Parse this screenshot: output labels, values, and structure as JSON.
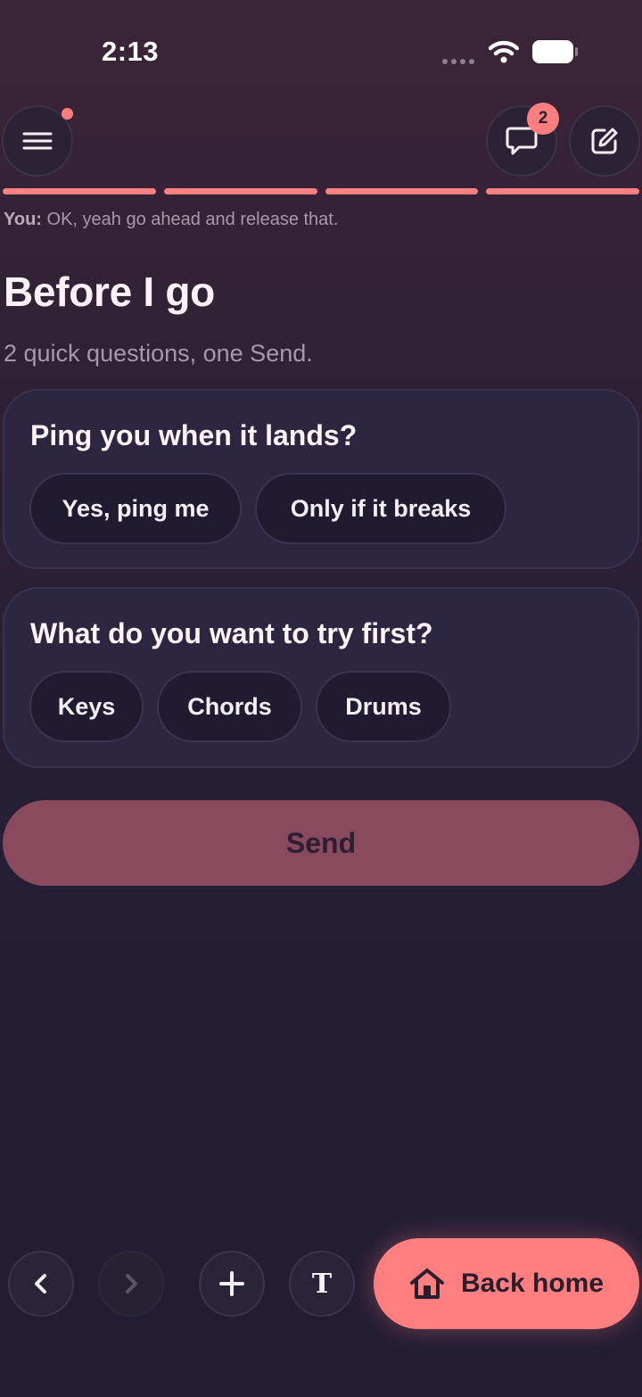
{
  "status_bar": {
    "time": "2:13"
  },
  "header": {
    "menu_icon": "hamburger-menu-icon",
    "chat_icon": "chat-bubble-icon",
    "chat_badge_count": "2",
    "edit_icon": "edit-square-icon",
    "progress_segments": 4,
    "progress_completed": 4
  },
  "last_message": {
    "speaker": "You:",
    "text": "OK, yeah go ahead and release that."
  },
  "page": {
    "title": "Before I go",
    "subtitle": "2 quick questions, one Send."
  },
  "questions": [
    {
      "question": "Ping you when it lands?",
      "options": [
        "Yes, ping me",
        "Only if it breaks"
      ]
    },
    {
      "question": "What do you want to try first?",
      "options": [
        "Keys",
        "Chords",
        "Drums"
      ]
    }
  ],
  "send_label": "Send",
  "toolbar": {
    "back_icon": "chevron-left-icon",
    "forward_icon": "chevron-right-icon",
    "add_icon": "plus-icon",
    "text_label": "T",
    "home_icon": "home-icon",
    "home_label": "Back home"
  },
  "colors": {
    "accent": "#ff7f80",
    "send_disabled": "#8a4a5e",
    "card": "#2d2641",
    "chip": "#211b31"
  }
}
